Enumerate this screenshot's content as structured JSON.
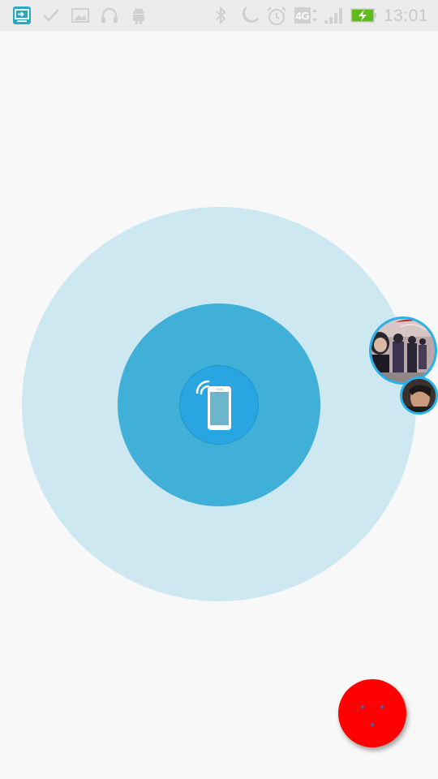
{
  "status_bar": {
    "time": "13:01",
    "network": "4G",
    "icons": [
      "screencast-icon",
      "check-icon",
      "image-icon",
      "headset-icon",
      "android-icon",
      "bluetooth-icon",
      "moon-icon",
      "alarm-icon",
      "network-4g-icon",
      "signal-icon",
      "battery-charging-icon"
    ]
  },
  "radar": {
    "outer_color": "#cde8f1",
    "inner_color": "#40b0d9",
    "center_color": "#29a6e1",
    "center_icon": "phone-broadcast-icon"
  },
  "nearby_users": [
    {
      "name": "user-avatar-1",
      "icon": "avatar"
    },
    {
      "name": "user-avatar-2",
      "icon": "avatar"
    }
  ],
  "fab": {
    "color": "#ff0000",
    "icon": "dots-icon"
  }
}
